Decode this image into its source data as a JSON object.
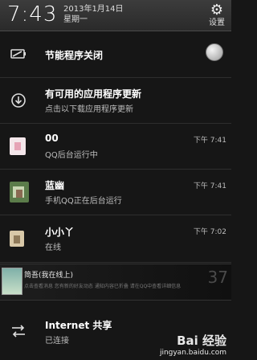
{
  "header": {
    "time": "7:43",
    "date": "2013年1月14日",
    "weekday": "星期一",
    "settings_label": "设置"
  },
  "rows": {
    "power_saving": {
      "title": "节能程序关闭"
    },
    "update": {
      "title": "有可用的应用程序更新",
      "sub": "点击以下载应用程序更新"
    },
    "qq1": {
      "title": "00",
      "sub": "QQ后台运行中",
      "time": "下午 7:41"
    },
    "qq2": {
      "title": "蓝幽",
      "sub": "手机QQ正在后台运行",
      "time": "下午 7:41"
    },
    "qq3": {
      "title": "小小丫",
      "sub": "在线",
      "time": "下午 7:02"
    }
  },
  "banner": {
    "title": "简吾(我在线上)",
    "text": "点击查看消息 您有新的好友动态 通知内容已折叠 请在QQ中查看详细信息",
    "number": "37"
  },
  "internet": {
    "title": "Internet 共享",
    "sub": "已连接"
  },
  "watermark": {
    "brand": "Bai 经验",
    "url": "jingyan.baidu.com"
  }
}
